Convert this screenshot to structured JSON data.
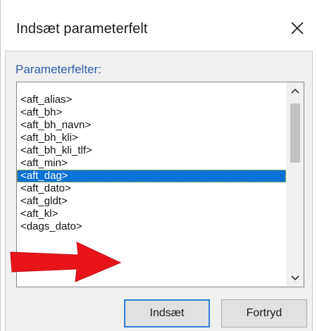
{
  "dialog": {
    "title": "Indsæt parameterfelt",
    "close_icon": "close-icon"
  },
  "group": {
    "label": "Parameterfelter:"
  },
  "list": {
    "items": [
      "<aft_alias>",
      "<aft_bh>",
      "<aft_bh_navn>",
      "<aft_bh_kli>",
      "<aft_bh_kli_tlf>",
      "<aft_min>",
      "<aft_dag>",
      "<aft_dato>",
      "<aft_gldt>",
      "<aft_kl>",
      "<dags_dato>"
    ],
    "selected": "<aft_dag>"
  },
  "buttons": {
    "insert_label": "Indsæt",
    "cancel_label": "Fortryd"
  },
  "annotation": {
    "arrow_color": "#e8141a",
    "arrow_icon": "red-arrow-right-icon"
  },
  "colors": {
    "selection": "#0a72d4",
    "label_blue": "#2e5ea8",
    "default_button_border": "#2f7fd6"
  }
}
